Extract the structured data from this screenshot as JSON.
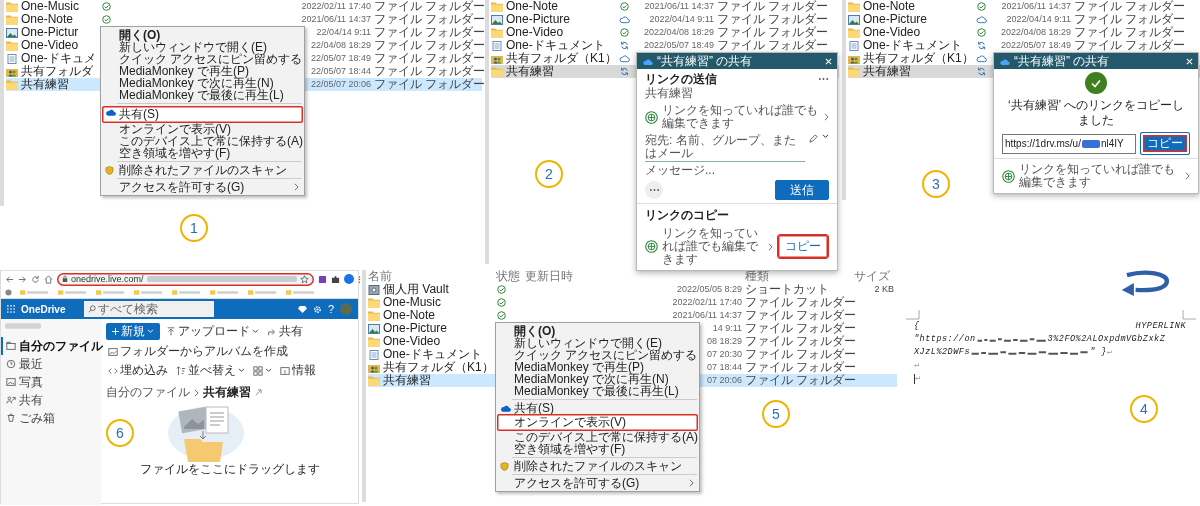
{
  "step1": {
    "step_label": "1",
    "explorer_focused": true,
    "rows": [
      {
        "kind": "folder",
        "name": "One-Music",
        "synced": true,
        "online_only": false,
        "syncing": false,
        "date": "2022/02/11 17:40",
        "type": "ファイル フォルダー",
        "selected": false
      },
      {
        "kind": "folder",
        "name": "One-Note",
        "synced": true,
        "online_only": false,
        "syncing": false,
        "date": "2021/06/11 14:37",
        "type": "ファイル フォルダー",
        "selected": false
      },
      {
        "kind": "picture",
        "name": "One-Pictur",
        "date": "22/04/14 9:11",
        "type": "ファイル フォルダー",
        "selected": false
      },
      {
        "kind": "folder",
        "name": "One-Video",
        "date": "22/04/08 18:29",
        "type": "ファイル フォルダー",
        "selected": false
      },
      {
        "kind": "document",
        "name": "One-ドキュメ",
        "date": "22/05/07 18:49",
        "type": "ファイル フォルダー",
        "selected": false
      },
      {
        "kind": "shared",
        "name": "共有フォルダ",
        "date": "22/05/07 18:44",
        "type": "ファイル フォルダー",
        "selected": false
      },
      {
        "kind": "folder",
        "name": "共有練習",
        "date": "22/05/07 20:06",
        "type": "ファイル フォルダー",
        "selected": true
      }
    ],
    "menu": [
      {
        "kind": "item",
        "label": "開く(O)",
        "default": true,
        "highlighted": false,
        "callout": false,
        "submenu": false
      },
      {
        "kind": "item",
        "label": "新しいウィンドウで開く(E)",
        "default": false,
        "highlighted": false,
        "callout": false,
        "submenu": false
      },
      {
        "kind": "item",
        "label": "クイック アクセスにピン留めする",
        "default": false,
        "highlighted": false,
        "callout": false,
        "submenu": false
      },
      {
        "kind": "item",
        "label": "MediaMonkey で再生(P)",
        "default": false,
        "highlighted": false,
        "callout": false,
        "submenu": false
      },
      {
        "kind": "item",
        "label": "MediaMonkey で次に再生(N)",
        "default": false,
        "highlighted": false,
        "callout": false,
        "submenu": false
      },
      {
        "kind": "item",
        "label": "MediaMonkey で最後に再生(L)",
        "default": false,
        "highlighted": false,
        "callout": false,
        "submenu": false
      },
      {
        "kind": "separator"
      },
      {
        "kind": "onedrive_item",
        "label": "共有(S)",
        "default": false,
        "highlighted": true,
        "callout": true,
        "submenu": false
      },
      {
        "kind": "item",
        "label": "オンラインで表示(V)",
        "default": false,
        "highlighted": false,
        "callout": false,
        "submenu": false
      },
      {
        "kind": "item",
        "label": "このデバイス上で常に保持する(A)",
        "default": false,
        "highlighted": false,
        "callout": false,
        "submenu": false
      },
      {
        "kind": "item",
        "label": "空き領域を増やす(F)",
        "default": false,
        "highlighted": false,
        "callout": false,
        "submenu": false
      },
      {
        "kind": "separator"
      },
      {
        "kind": "scan_item",
        "label": "削除されたファイルのスキャン",
        "default": false,
        "highlighted": false,
        "callout": false,
        "submenu": false
      },
      {
        "kind": "separator"
      },
      {
        "kind": "item",
        "label": "アクセスを許可する(G)",
        "default": false,
        "highlighted": false,
        "callout": false,
        "submenu": true
      }
    ]
  },
  "step2": {
    "step_label": "2",
    "explorer_focused": false,
    "rows": [
      {
        "kind": "folder",
        "name": "One-Note",
        "synced": true,
        "online_only": false,
        "syncing": false,
        "date": "2021/06/11 14:37",
        "type": "ファイル フォルダー",
        "selected": false
      },
      {
        "kind": "picture",
        "name": "One-Picture",
        "synced": false,
        "online_only": true,
        "syncing": false,
        "date": "2022/04/14 9:11",
        "type": "ファイル フォルダー",
        "selected": false
      },
      {
        "kind": "folder",
        "name": "One-Video",
        "synced": true,
        "online_only": false,
        "syncing": false,
        "date": "2022/04/08 18:29",
        "type": "ファイル フォルダー",
        "selected": false
      },
      {
        "kind": "document",
        "name": "One-ドキュメント",
        "synced": false,
        "online_only": false,
        "syncing": true,
        "date": "2022/05/07 18:49",
        "type": "ファイル フォルダー",
        "selected": false
      },
      {
        "kind": "shared",
        "name": "共有フォルダ（K1）",
        "synced": false,
        "online_only": true,
        "syncing": false,
        "selected": false
      },
      {
        "kind": "folder",
        "name": "共有練習",
        "synced": false,
        "online_only": false,
        "syncing": true,
        "selected": true
      }
    ],
    "dialog": {
      "title": "“共有練習” の共有",
      "heading": "リンクの送信",
      "item_name": "共有練習",
      "link_setting": "リンクを知っていれば誰でも編集できます",
      "to_placeholder": "宛先: 名前、グループ、またはメール",
      "message_placeholder": "メッセージ...",
      "send_label": "送信",
      "copy_heading": "リンクのコピー",
      "copy_link_setting": "リンクを知っていれば誰でも編集できます",
      "copy_label": "コピー",
      "copy_callout": true
    }
  },
  "step3": {
    "step_label": "3",
    "explorer_focused": false,
    "rows": [
      {
        "kind": "folder",
        "name": "One-Note",
        "synced": true,
        "online_only": false,
        "syncing": false,
        "date": "2021/06/11 14:37",
        "type": "ファイル フォルダー",
        "selected": false
      },
      {
        "kind": "picture",
        "name": "One-Picture",
        "synced": false,
        "online_only": true,
        "syncing": false,
        "date": "2022/04/14 9:11",
        "type": "ファイル フォルダー",
        "selected": false
      },
      {
        "kind": "folder",
        "name": "One-Video",
        "synced": true,
        "online_only": false,
        "syncing": false,
        "date": "2022/04/08 18:29",
        "type": "ファイル フォルダー",
        "selected": false
      },
      {
        "kind": "document",
        "name": "One-ドキュメント",
        "synced": false,
        "online_only": false,
        "syncing": true,
        "date": "2022/05/07 18:49",
        "type": "ファイル フォルダー",
        "selected": false
      },
      {
        "kind": "shared",
        "name": "共有フォルダ（K1）",
        "synced": false,
        "online_only": true,
        "syncing": false,
        "selected": false
      },
      {
        "kind": "folder",
        "name": "共有練習",
        "synced": false,
        "online_only": false,
        "syncing": true,
        "selected": true
      }
    ],
    "dialog": {
      "title": "“共有練習” の共有",
      "message": "‘共有練習’ へのリンクをコピーしました",
      "url_start": "https://1drv.ms/u/",
      "url_end": "nl4IY",
      "copy_label": "コピー",
      "copy_callout": true,
      "link_setting": "リンクを知っていれば誰でも編集できます"
    }
  },
  "step6": {
    "step_label": "6",
    "address": "onedrive.live.com/",
    "address_callout": true,
    "app_name": "OneDrive",
    "search_placeholder": "すべて検索",
    "help_label": "?",
    "nav": [
      {
        "kind": "folder",
        "label": "自分のファイル",
        "selected": true
      },
      {
        "kind": "recent",
        "label": "最近",
        "selected": false
      },
      {
        "kind": "photos",
        "label": "写真",
        "selected": false
      },
      {
        "kind": "shared",
        "label": "共有",
        "selected": false
      },
      {
        "kind": "trash",
        "label": "ごみ箱",
        "selected": false
      }
    ],
    "toolbar": [
      {
        "kind": "new",
        "label": "新規",
        "caret": true
      },
      {
        "kind": "upload",
        "label": "アップロード",
        "caret": true
      },
      {
        "kind": "share",
        "label": "共有",
        "caret": false
      },
      {
        "kind": "album",
        "label": "フォルダーからアルバムを作成",
        "caret": false
      },
      {
        "kind": "embed",
        "label": "埋め込み",
        "caret": false
      },
      {
        "kind": "sort",
        "label": "並べ替え",
        "caret": true
      },
      {
        "kind": "view",
        "caret": true
      },
      {
        "kind": "info",
        "label": "情報",
        "caret": false
      }
    ],
    "breadcrumb": [
      {
        "label": "自分のファイル",
        "current": false
      },
      {
        "label": "共有練習",
        "current": true
      }
    ],
    "empty_text": "ファイルをここにドラッグします"
  },
  "step5": {
    "step_label": "5",
    "explorer_focused": true,
    "columns": [
      "名前",
      "状態",
      "更新日時",
      "種類",
      "サイズ"
    ],
    "rows": [
      {
        "kind": "safe",
        "name": "個人用 Vault",
        "synced": true,
        "online_only": false,
        "syncing": false,
        "date": "2022/05/05 8:29",
        "type": "ショートカット",
        "size": "2 KB",
        "selected": false
      },
      {
        "kind": "folder",
        "name": "One-Music",
        "synced": true,
        "online_only": false,
        "syncing": false,
        "date": "2022/02/11 17:40",
        "type": "ファイル フォルダー",
        "selected": false
      },
      {
        "kind": "folder",
        "name": "One-Note",
        "synced": true,
        "online_only": false,
        "syncing": false,
        "date": "2021/06/11 14:37",
        "type": "ファイル フォルダー",
        "selected": false
      },
      {
        "kind": "picture",
        "name": "One-Picture",
        "date": "14 9:11",
        "type": "ファイル フォルダー",
        "selected": false
      },
      {
        "kind": "folder",
        "name": "One-Video",
        "date": "08 18:29",
        "type": "ファイル フォルダー",
        "selected": false
      },
      {
        "kind": "document",
        "name": "One-ドキュメント",
        "date": "07 20:30",
        "type": "ファイル フォルダー",
        "selected": false
      },
      {
        "kind": "shared",
        "name": "共有フォルダ（K1）",
        "date": "07 18:44",
        "type": "ファイル フォルダー",
        "selected": false
      },
      {
        "kind": "folder",
        "name": "共有練習",
        "date": "07 20:06",
        "type": "ファイル フォルダー",
        "selected": true
      }
    ],
    "menu": [
      {
        "kind": "item",
        "label": "開く(O)",
        "default": true,
        "highlighted": false,
        "callout": false,
        "submenu": false
      },
      {
        "kind": "item",
        "label": "新しいウィンドウで開く(E)",
        "default": false,
        "highlighted": false,
        "callout": false,
        "submenu": false
      },
      {
        "kind": "item",
        "label": "クイック アクセスにピン留めする",
        "default": false,
        "highlighted": false,
        "callout": false,
        "submenu": false
      },
      {
        "kind": "item",
        "label": "MediaMonkey で再生(P)",
        "default": false,
        "highlighted": false,
        "callout": false,
        "submenu": false
      },
      {
        "kind": "item",
        "label": "MediaMonkey で次に再生(N)",
        "default": false,
        "highlighted": false,
        "callout": false,
        "submenu": false
      },
      {
        "kind": "item",
        "label": "MediaMonkey で最後に再生(L)",
        "default": false,
        "highlighted": false,
        "callout": false,
        "submenu": false
      },
      {
        "kind": "separator"
      },
      {
        "kind": "onedrive_item",
        "label": "共有(S)",
        "default": false,
        "highlighted": false,
        "callout": false,
        "submenu": false
      },
      {
        "kind": "item",
        "label": "オンラインで表示(V)",
        "default": false,
        "highlighted": true,
        "callout": true,
        "submenu": false
      },
      {
        "kind": "item",
        "label": "このデバイス上で常に保持する(A)",
        "default": false,
        "highlighted": false,
        "callout": false,
        "submenu": false
      },
      {
        "kind": "item",
        "label": "空き領域を増やす(F)",
        "default": false,
        "highlighted": false,
        "callout": false,
        "submenu": false
      },
      {
        "kind": "separator"
      },
      {
        "kind": "scan_item",
        "label": "削除されたファイルのスキャン",
        "default": false,
        "highlighted": false,
        "callout": false,
        "submenu": false
      },
      {
        "kind": "separator"
      },
      {
        "kind": "item",
        "label": "アクセスを許可する(G)",
        "default": false,
        "highlighted": false,
        "callout": false,
        "submenu": true
      }
    ]
  },
  "step4": {
    "step_label": "4",
    "field_open": "{",
    "field_keyword": "HYPERLINK",
    "line2_start": "\"https://on",
    "line2_end": "3%2FO%2ALOxpdmVGbZxkZ",
    "line3_start": "XJzL%2DWFs",
    "line3_end": "\" }",
    "paragraph_marks": [
      "↵",
      "↵",
      "↵"
    ]
  }
}
